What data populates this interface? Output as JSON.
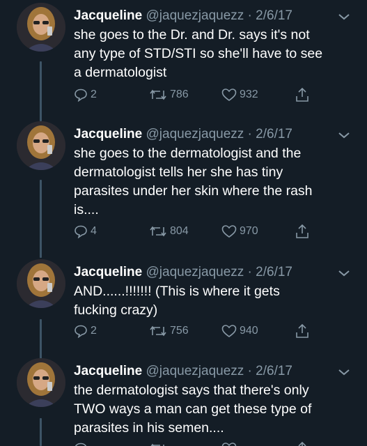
{
  "colors": {
    "background": "#141d26",
    "text_primary": "#ffffff",
    "text_secondary": "#8899a6",
    "thread_line": "#3d5466"
  },
  "tweets": [
    {
      "name": "Jacqueline",
      "handle": "@jaquezjaquezz",
      "separator": "·",
      "date": "2/6/17",
      "lines": [
        "she goes to the Dr. and Dr. says it's not",
        "any type of STD/STI so she'll have to see",
        "a dermatologist"
      ],
      "replies": "2",
      "retweets": "786",
      "likes": "932"
    },
    {
      "name": "Jacqueline",
      "handle": "@jaquezjaquezz",
      "separator": "·",
      "date": "2/6/17",
      "lines": [
        "she goes to the dermatologist and the",
        "dermatologist tells her she has tiny",
        "parasites under her skin where the rash",
        "is...."
      ],
      "replies": "4",
      "retweets": "804",
      "likes": "970"
    },
    {
      "name": "Jacqueline",
      "handle": "@jaquezjaquezz",
      "separator": "·",
      "date": "2/6/17",
      "lines": [
        "AND......!!!!!!! (This is where it gets",
        "fucking crazy)"
      ],
      "replies": "2",
      "retweets": "756",
      "likes": "940"
    },
    {
      "name": "Jacqueline",
      "handle": "@jaquezjaquezz",
      "separator": "·",
      "date": "2/6/17",
      "lines": [
        "the dermatologist says that there's only",
        "TWO ways a man can get these type of",
        "parasites in his semen...."
      ],
      "replies": "",
      "retweets": "",
      "likes": ""
    }
  ],
  "icons": {
    "reply": "reply-icon",
    "retweet": "retweet-icon",
    "like": "heart-icon",
    "share": "share-icon",
    "menu": "chevron-down-icon"
  }
}
